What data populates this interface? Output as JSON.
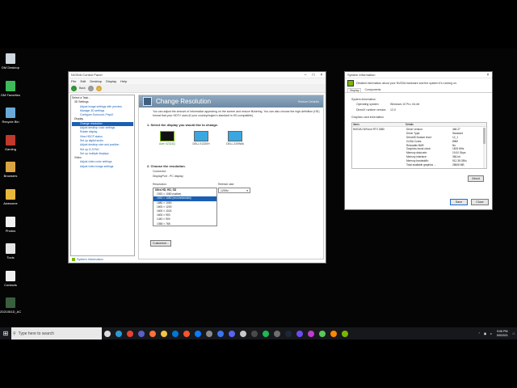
{
  "desktop": {
    "icons": [
      {
        "label": "DM Desktop",
        "color": "#cfd7df",
        "icon": "monitor-file-icon"
      },
      {
        "label": "DM Favorites",
        "color": "#3dbb5b",
        "icon": "green-file-icon"
      },
      {
        "label": "Recycle Bin",
        "color": "#6aa9d8",
        "icon": "recycle-bin-icon"
      },
      {
        "label": "Gaming",
        "color": "#c0392b",
        "icon": "gaming-icon"
      },
      {
        "label": "Browsers",
        "color": "#d9a441",
        "icon": "browsers-folder-icon"
      },
      {
        "label": "Awesome",
        "color": "#e8b73b",
        "icon": "folder-icon"
      },
      {
        "label": "Photos",
        "color": "#f2f2f2",
        "icon": "photos-file-icon"
      },
      {
        "label": "Tools",
        "color": "#e5e5e5",
        "icon": "tools-icon"
      },
      {
        "label": "Contacts",
        "color": "#f0f0f0",
        "icon": "contacts-file-icon"
      },
      {
        "label": "2021061D_ACE...",
        "color": "#3a5f3e",
        "icon": "image-file-icon"
      }
    ]
  },
  "control_panel": {
    "title": "NVIDIA Control Panel",
    "menu": [
      "File",
      "Edit",
      "Desktop",
      "Display",
      "Help"
    ],
    "back_label": "Back",
    "tree_label": "Select a Task...",
    "tree": [
      {
        "text": "3D Settings",
        "type": "cat"
      },
      {
        "text": "Adjust image settings with preview",
        "type": "item"
      },
      {
        "text": "Manage 3D settings",
        "type": "item"
      },
      {
        "text": "Configure Surround, PhysX",
        "type": "item"
      },
      {
        "text": "Display",
        "type": "cat"
      },
      {
        "text": "Change resolution",
        "type": "sel"
      },
      {
        "text": "Adjust desktop color settings",
        "type": "item"
      },
      {
        "text": "Rotate display",
        "type": "item"
      },
      {
        "text": "View HDCP status",
        "type": "item"
      },
      {
        "text": "Set up digital audio",
        "type": "item"
      },
      {
        "text": "Adjust desktop size and position",
        "type": "item"
      },
      {
        "text": "Set up G-SYNC",
        "type": "item"
      },
      {
        "text": "Set up multiple displays",
        "type": "item"
      },
      {
        "text": "Video",
        "type": "cat"
      },
      {
        "text": "Adjust video color settings",
        "type": "item"
      },
      {
        "text": "Adjust video image settings",
        "type": "item"
      }
    ],
    "page_title": "Change Resolution",
    "restore_defaults": "Restore Defaults",
    "description": "You can adjust the amount of information appearing on the screen and reduce flickering. You can also choose the high-definition (HD) format that your HDTV uses (if your country/region's standard is HD-compatible).",
    "step1": "1. Select the display you would like to change.",
    "displays": [
      {
        "label": "Acer XZ322Q",
        "selected": true
      },
      {
        "label": "DELL E2220H",
        "selected": false
      },
      {
        "label": "DELL 2209WA",
        "selected": false
      }
    ],
    "step2": "2. Choose the resolution.",
    "connector_label": "Connector:",
    "connector_value": "DisplayPort - PC display",
    "resolution_label": "Resolution:",
    "refresh_label": "Refresh rate:",
    "refresh_value": "120Hz",
    "resolution_group": "Ultra HD, HD, SD",
    "resolutions": [
      "1920 × 1080 (native)",
      "1920 × 1080 (recommended)",
      "1680 × 1050",
      "1600 × 1200",
      "1600 × 1024",
      "1600 × 900",
      "1440 × 900",
      "1366 × 768",
      "1280 × 1024",
      "1280 × 800"
    ],
    "selected_resolution_index": 1,
    "customize_label": "Customize...",
    "system_info_link": "System Information"
  },
  "system_info": {
    "title": "System Information",
    "description": "Detailed information about your NVIDIA hardware and the system it's running on.",
    "tabs": [
      "Display",
      "Components"
    ],
    "system_info_header": "System information",
    "os_key": "Operating system:",
    "os_value": "Windows 10 Pro, 64-bit",
    "dx_key": "DirectX runtime version:",
    "dx_value": "12.0",
    "graphics_header": "Graphics card information",
    "col_items": "Items",
    "col_details": "Details",
    "item": "NVIDIA GeForce RTX 3080",
    "details": [
      [
        "Driver version:",
        "466.27"
      ],
      [
        "Driver Type:",
        "Standard"
      ],
      [
        "Direct3D feature level:",
        "12_1"
      ],
      [
        "CUDA Cores:",
        "8960"
      ],
      [
        "Resizable BAR:",
        "No"
      ],
      [
        "Graphics boost clock:",
        "1815 MHz"
      ],
      [
        "Memory data rate:",
        "19.00 Gbps"
      ],
      [
        "Memory interface:",
        "384-bit"
      ],
      [
        "Memory bandwidth:",
        "912.38 GB/s"
      ],
      [
        "Total available graphics ...",
        "28608 MB"
      ]
    ],
    "about_label": "About",
    "save_label": "Save",
    "close_label": "Close"
  },
  "taskbar": {
    "search_placeholder": "Type here to search",
    "apps": [
      {
        "icon": "task-view-icon",
        "color": "#dddddd"
      },
      {
        "icon": "edge-icon",
        "color": "#2a9bd6"
      },
      {
        "icon": "chrome-icon",
        "color": "#e94235"
      },
      {
        "icon": "teams-icon",
        "color": "#5b5fc7"
      },
      {
        "icon": "firefox-icon",
        "color": "#ff7139"
      },
      {
        "icon": "explorer-icon",
        "color": "#f4c542"
      },
      {
        "icon": "store-icon",
        "color": "#0078d4"
      },
      {
        "icon": "brave-icon",
        "color": "#fb542b"
      },
      {
        "icon": "messenger-icon",
        "color": "#0a7cff"
      },
      {
        "icon": "app-icon",
        "color": "#8a8a8a"
      },
      {
        "icon": "signal-icon",
        "color": "#3a76f0"
      },
      {
        "icon": "discord-icon",
        "color": "#5865f2"
      },
      {
        "icon": "lock-icon",
        "color": "#c8c8c8"
      },
      {
        "icon": "terminal-icon",
        "color": "#4a4a4a"
      },
      {
        "icon": "spotify-icon",
        "color": "#1db954"
      },
      {
        "icon": "obs-icon",
        "color": "#6f6f6f"
      },
      {
        "icon": "steam-icon",
        "color": "#1b2838"
      },
      {
        "icon": "mpc-icon",
        "color": "#6b4cf0"
      },
      {
        "icon": "k-icon",
        "color": "#c23ad0"
      },
      {
        "icon": "media-icon",
        "color": "#5ac85a"
      },
      {
        "icon": "vlc-icon",
        "color": "#ff8800"
      },
      {
        "icon": "nvidia-icon",
        "color": "#76b900"
      }
    ],
    "time": "9:06 PM",
    "date": "5/5/2021"
  }
}
